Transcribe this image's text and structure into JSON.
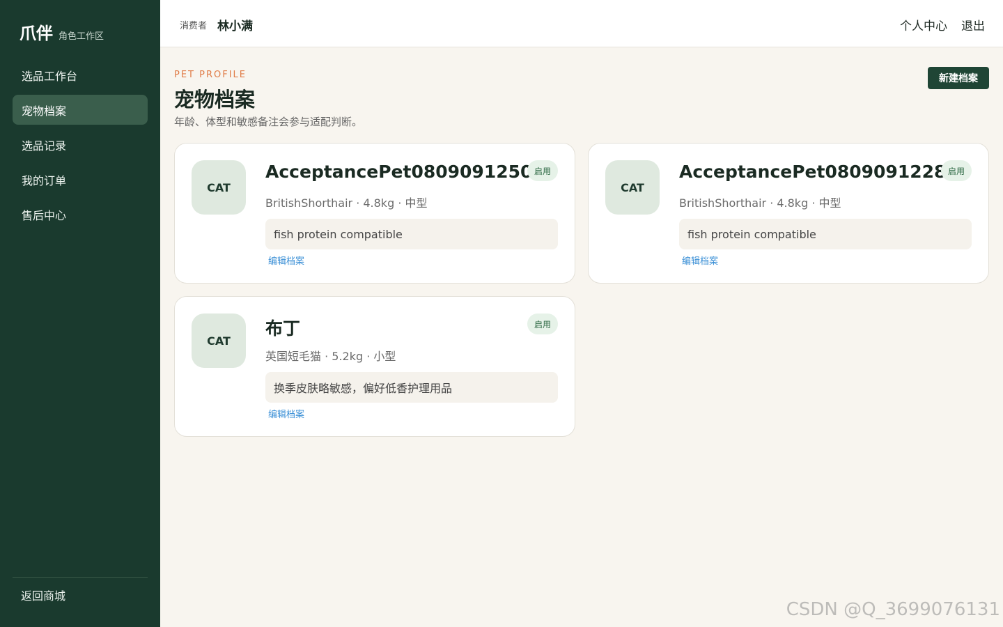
{
  "sidebar": {
    "brand_name": "爪伴",
    "brand_sub": "角色工作区",
    "items": [
      {
        "label": "选品工作台"
      },
      {
        "label": "宠物档案"
      },
      {
        "label": "选品记录"
      },
      {
        "label": "我的订单"
      },
      {
        "label": "售后中心"
      }
    ],
    "active_index": 1,
    "back_label": "返回商城"
  },
  "topbar": {
    "role_label": "消费者",
    "user_name": "林小满",
    "profile_link": "个人中心",
    "logout_link": "退出"
  },
  "page": {
    "eyebrow": "PET PROFILE",
    "title": "宠物档案",
    "description": "年龄、体型和敏感备注会参与适配判断。",
    "new_button": "新建档案"
  },
  "pets": [
    {
      "avatar": "CAT",
      "name": "AcceptancePet0809091250",
      "status": "启用",
      "meta": "BritishShorthair · 4.8kg · 中型",
      "note": "fish protein compatible",
      "edit_label": "编辑档案"
    },
    {
      "avatar": "CAT",
      "name": "AcceptancePet0809091228",
      "status": "启用",
      "meta": "BritishShorthair · 4.8kg · 中型",
      "note": "fish protein compatible",
      "edit_label": "编辑档案"
    },
    {
      "avatar": "CAT",
      "name": "布丁",
      "status": "启用",
      "meta": "英国短毛猫 · 5.2kg · 小型",
      "note": "换季皮肤略敏感，偏好低香护理用品",
      "edit_label": "编辑档案"
    }
  ],
  "watermark": "CSDN @Q_3699076131",
  "colors": {
    "sidebar_bg": "#1a3a2e",
    "active_nav": "#3a5e4c",
    "accent_orange": "#e07b46",
    "button_bg": "#1f4535",
    "page_bg": "#f8f5ef"
  }
}
